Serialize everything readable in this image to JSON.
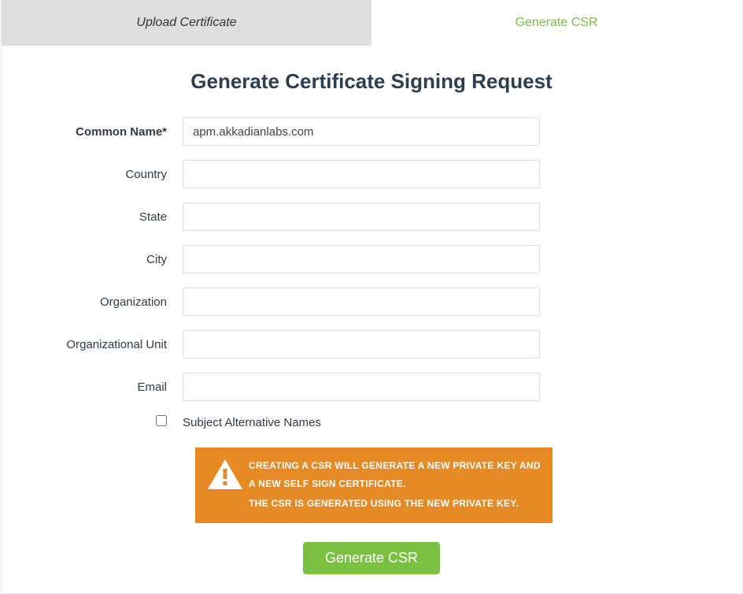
{
  "tabs": {
    "upload": "Upload Certificate",
    "generate": "Generate CSR"
  },
  "title": "Generate Certificate Signing Request",
  "fields": {
    "common_name": {
      "label": "Common Name*",
      "value": "apm.akkadianlabs.com"
    },
    "country": {
      "label": "Country",
      "value": ""
    },
    "state": {
      "label": "State",
      "value": ""
    },
    "city": {
      "label": "City",
      "value": ""
    },
    "organization": {
      "label": "Organization",
      "value": ""
    },
    "org_unit": {
      "label": "Organizational Unit",
      "value": ""
    },
    "email": {
      "label": "Email",
      "value": ""
    }
  },
  "san_label": "Subject Alternative Names",
  "warning": {
    "line1": "CREATING A CSR WILL GENERATE A NEW PRIVATE KEY AND A NEW SELF SIGN CERTIFICATE.",
    "line2": "THE CSR IS GENERATED USING THE NEW PRIVATE KEY."
  },
  "submit_label": "Generate CSR"
}
